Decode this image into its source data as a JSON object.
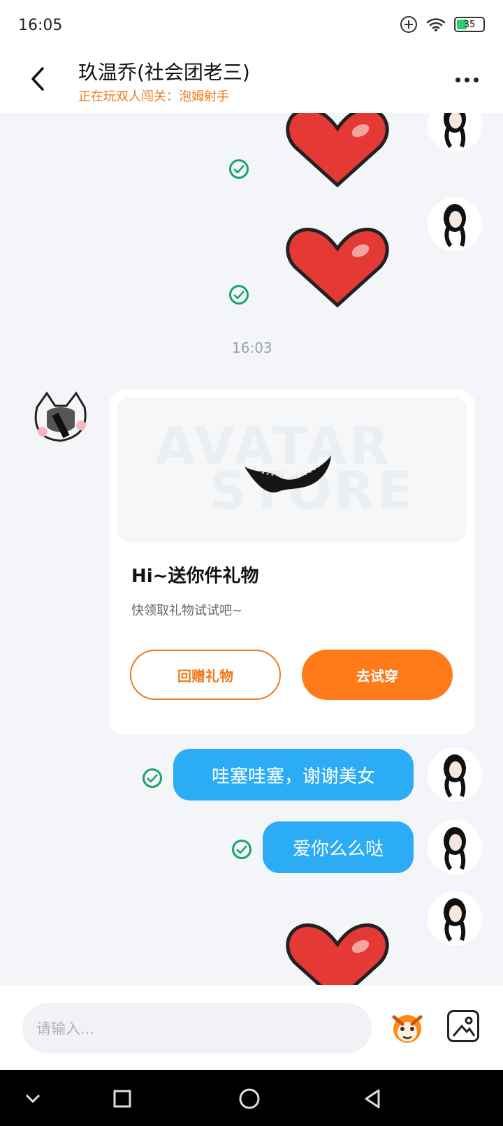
{
  "status_bar": {
    "time": "16:05",
    "battery": "35"
  },
  "header": {
    "back_icon": "chevron-left",
    "title": "玖温乔(社会团老三)",
    "subtitle": "正在玩双人闯关：泡姆射手",
    "more_icon": "more-dots"
  },
  "messages": {
    "timestamp_1": "16:03",
    "gift_card": {
      "title": "Hi~送你件礼物",
      "description": "快领取礼物试试吧~",
      "button_return": "回赠礼物",
      "button_try": "去试穿",
      "watermark_top": "AVATAR",
      "watermark_bottom": "STORE"
    },
    "bubble_1": "哇塞哇塞，谢谢美女",
    "bubble_2": "爱你么么哒"
  },
  "composer": {
    "placeholder": "请输入..."
  },
  "colors": {
    "accent": "#f07a1b",
    "bubble": "#2cacf5",
    "check": "#16a56a",
    "heart": "#e53935"
  }
}
